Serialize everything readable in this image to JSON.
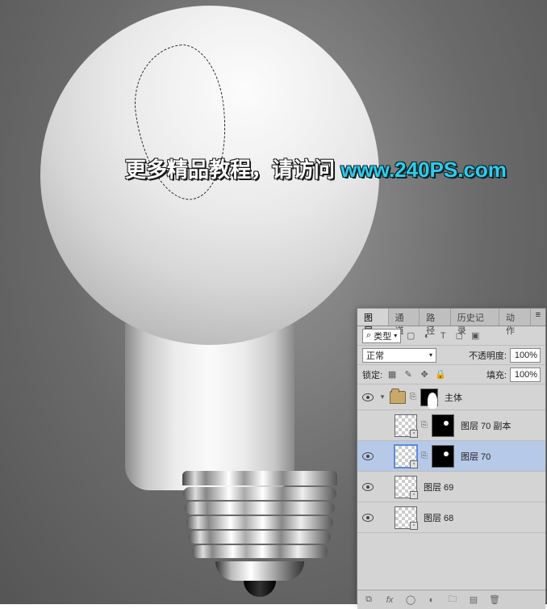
{
  "watermark": {
    "text_cn": "更多精品教程，请访问 ",
    "url": "www.240PS.com"
  },
  "panel": {
    "tabs": {
      "layers": "图层",
      "channels": "通道",
      "paths": "路径",
      "history": "历史记录",
      "actions": "动作"
    },
    "filter_kind": "类型",
    "blend_mode": "正常",
    "opacity_label": "不透明度:",
    "opacity_value": "100%",
    "lock_label": "锁定:",
    "fill_label": "填充:",
    "fill_value": "100%",
    "search_icon": "⌕"
  },
  "layers": {
    "group_name": "主体",
    "layer70copy": "图层 70 副本",
    "layer70": "图层 70",
    "layer69": "图层 69",
    "layer68": "图层 68"
  },
  "icons": {
    "image": "▢",
    "adjust": "◐",
    "text": "T",
    "shape": "◻",
    "smart": "▣",
    "lockpix": "▦",
    "brush": "✎",
    "move": "✥",
    "lock": "🔒",
    "link": "⧉",
    "fx": "fx",
    "mask": "◯",
    "newfill": "◐",
    "folder": "🗀",
    "new": "▤",
    "trash": "🗑",
    "menu": "≡",
    "triangle_down": "▾",
    "triangle_right": "▸"
  }
}
